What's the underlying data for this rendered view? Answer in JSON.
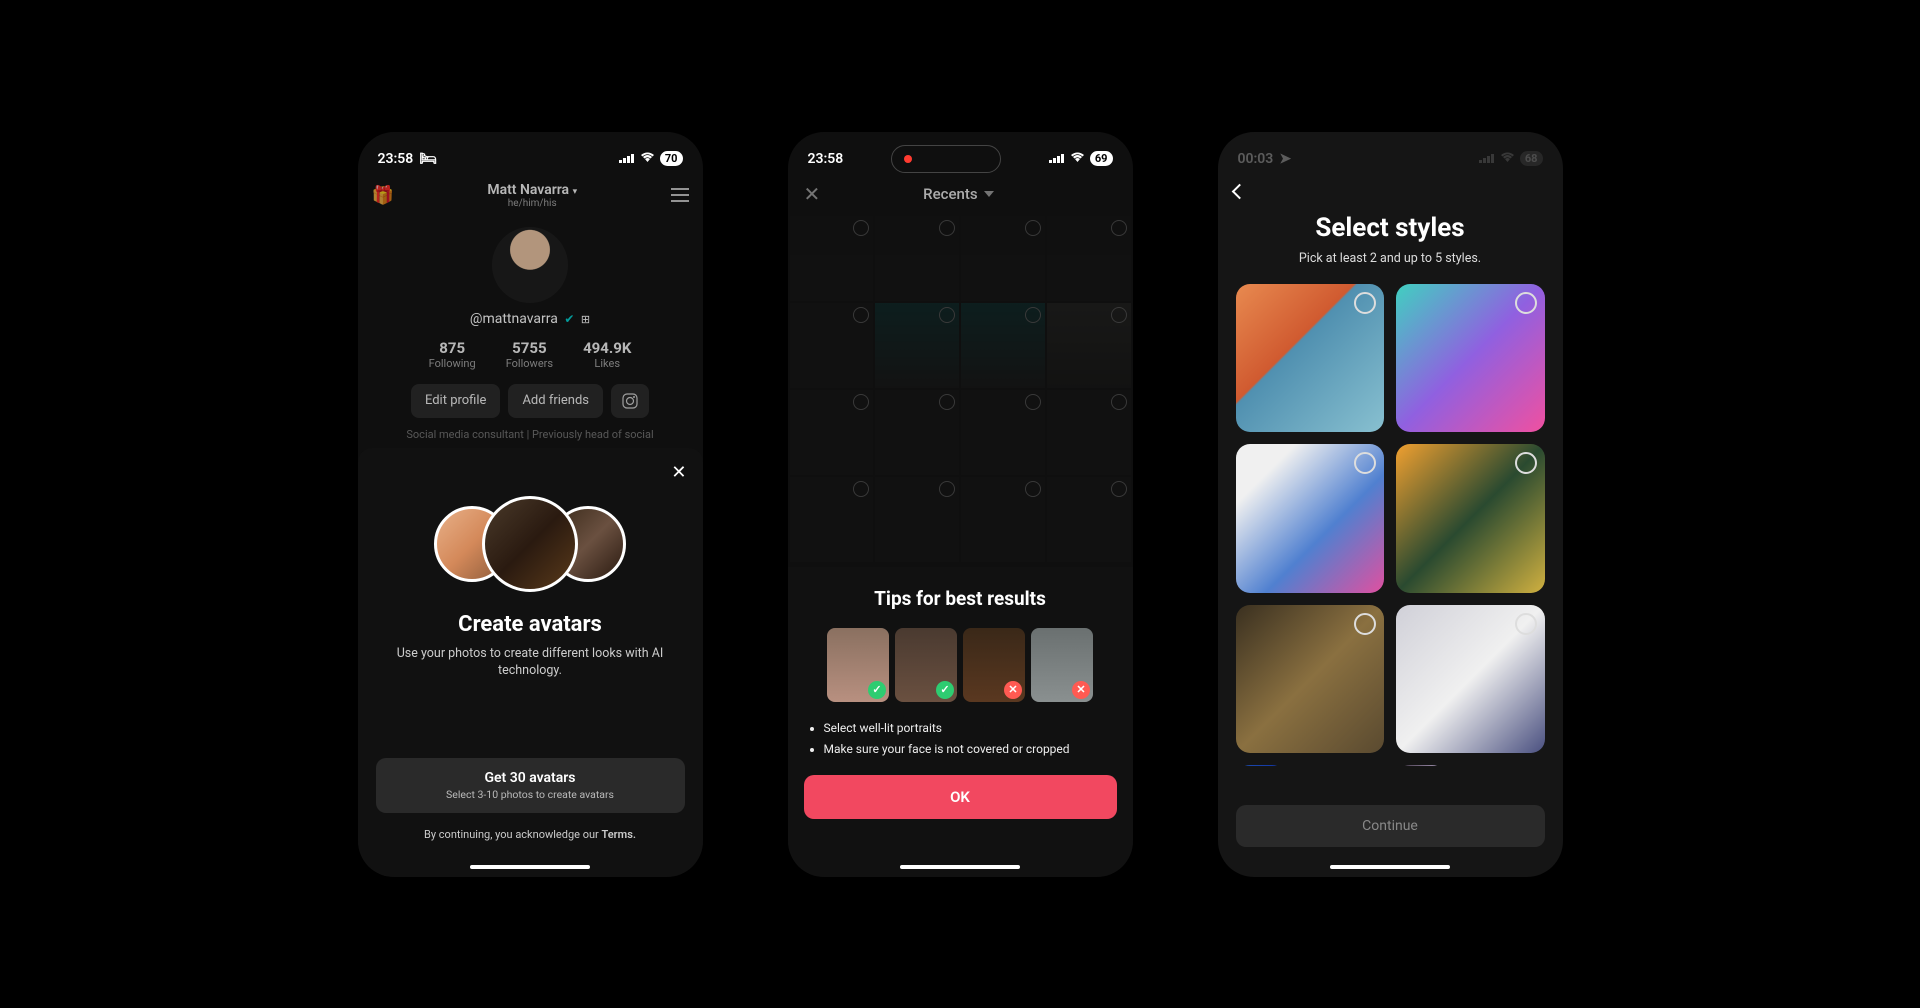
{
  "phone1": {
    "status": {
      "time": "23:58",
      "sleep_icon": "🛏",
      "battery": "70"
    },
    "header": {
      "name": "Matt Navarra",
      "pronouns": "he/him/his"
    },
    "handle": "@mattnavarra",
    "stats": {
      "following": {
        "num": "875",
        "label": "Following"
      },
      "followers": {
        "num": "5755",
        "label": "Followers"
      },
      "likes": {
        "num": "494.9K",
        "label": "Likes"
      }
    },
    "buttons": {
      "edit": "Edit profile",
      "add": "Add friends"
    },
    "bio": "Social media consultant | Previously head of social",
    "sheet": {
      "title": "Create avatars",
      "subtitle": "Use your photos to create different looks with AI technology.",
      "cta_title": "Get 30 avatars",
      "cta_sub": "Select 3-10 photos to create avatars",
      "terms_prefix": "By continuing, you acknowledge our ",
      "terms_link": "Terms."
    }
  },
  "phone2": {
    "status": {
      "time": "23:58",
      "battery": "69"
    },
    "picker_title": "Recents",
    "sheet": {
      "title": "Tips for best results",
      "tips": [
        "Select well-lit portraits",
        "Make sure your face is not covered or cropped"
      ],
      "ok": "OK"
    }
  },
  "phone3": {
    "status": {
      "time": "00:03",
      "battery": "68"
    },
    "title": "Select styles",
    "subtitle": "Pick at least 2 and up to 5 styles.",
    "continue": "Continue"
  }
}
